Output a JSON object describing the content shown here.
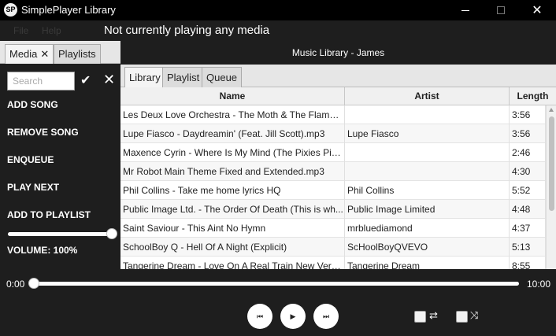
{
  "window": {
    "icon_text": "SP",
    "title": "SimplePlayer Library",
    "minimize": "minimize-icon",
    "maximize": "maximize-icon",
    "close_glyph": "✕"
  },
  "menu": {
    "file": "File",
    "help": "Help"
  },
  "now_playing": "Not currently playing any media",
  "left_tabs": {
    "media": "Media",
    "media_close": "✕",
    "playlists": "Playlists"
  },
  "search": {
    "placeholder": "Search",
    "confirm_glyph": "✔",
    "clear_glyph": "✕"
  },
  "actions": {
    "add_song": "ADD SONG",
    "remove_song": "REMOVE SONG",
    "enqueue": "ENQUEUE",
    "play_next": "PLAY NEXT",
    "add_to_playlist": "ADD TO PLAYLIST"
  },
  "volume": {
    "label": "VOLUME: 100%",
    "level": 1.0
  },
  "library_header": "Music Library - James",
  "right_tabs": {
    "library": "Library",
    "playlist": "Playlist",
    "queue": "Queue"
  },
  "table": {
    "columns": {
      "name": "Name",
      "artist": "Artist",
      "length": "Length"
    },
    "rows": [
      {
        "name": "Les Deux Love Orchestra - The Moth & The Flame (...",
        "artist": "",
        "length": "3:56"
      },
      {
        "name": "Lupe Fiasco - Daydreamin' (Feat. Jill Scott).mp3",
        "artist": "Lupe Fiasco",
        "length": "3:56"
      },
      {
        "name": "Maxence Cyrin - Where Is My Mind (The Pixies Pia...",
        "artist": "",
        "length": "2:46"
      },
      {
        "name": "Mr Robot Main Theme Fixed and Extended.mp3",
        "artist": "",
        "length": "4:30"
      },
      {
        "name": "Phil Collins - Take me home lyrics HQ",
        "artist": "Phil Collins",
        "length": "5:52"
      },
      {
        "name": "Public Image Ltd. - The Order Of Death (This is wh...",
        "artist": "Public Image Limited",
        "length": "4:48"
      },
      {
        "name": "Saint Saviour - This Aint No Hymn",
        "artist": "mrbluediamond",
        "length": "4:37"
      },
      {
        "name": "SchoolBoy Q - Hell Of A Night (Explicit)",
        "artist": "ScHoolBoyQVEVO",
        "length": "5:13"
      },
      {
        "name": "Tangerine Dream - Love On A Real Train New Versi...",
        "artist": "Tangerine Dream",
        "length": "8:55"
      }
    ]
  },
  "player": {
    "elapsed": "0:00",
    "total": "10:00",
    "progress": 0.0,
    "prev_glyph": "⏮",
    "play_glyph": "▶",
    "next_glyph": "⏭",
    "repeat_glyph": "⇄",
    "shuffle_glyph": "⤨"
  }
}
